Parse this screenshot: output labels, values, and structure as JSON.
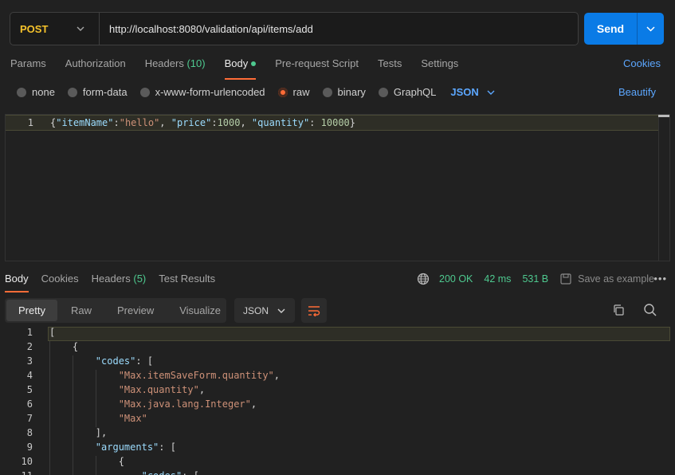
{
  "request": {
    "method": "POST",
    "url": "http://localhost:8080/validation/api/items/add",
    "send_label": "Send",
    "tabs": [
      {
        "label": "Params"
      },
      {
        "label": "Authorization"
      },
      {
        "label": "Headers",
        "count": "(10)"
      },
      {
        "label": "Body"
      },
      {
        "label": "Pre-request Script"
      },
      {
        "label": "Tests"
      },
      {
        "label": "Settings"
      }
    ],
    "cookies_label": "Cookies",
    "body_types": [
      "none",
      "form-data",
      "x-www-form-urlencoded",
      "raw",
      "binary",
      "GraphQL"
    ],
    "selected_body_type": "raw",
    "format": "JSON",
    "beautify_label": "Beautify",
    "editor": {
      "line_number": "1",
      "code": "{\"itemName\":\"hello\", \"price\":1000, \"quantity\": 10000}"
    }
  },
  "response": {
    "tabs": [
      {
        "label": "Body"
      },
      {
        "label": "Cookies"
      },
      {
        "label": "Headers",
        "count": "(5)"
      },
      {
        "label": "Test Results"
      }
    ],
    "status": "200 OK",
    "time": "42 ms",
    "size": "531 B",
    "save_example_label": "Save as example",
    "more_label": "•••",
    "view_tabs": [
      "Pretty",
      "Raw",
      "Preview",
      "Visualize"
    ],
    "format": "JSON",
    "lines": [
      {
        "n": "1",
        "tokens": [
          {
            "t": "[",
            "c": "p"
          }
        ]
      },
      {
        "n": "2",
        "tokens": [
          {
            "t": "    {",
            "c": "p"
          }
        ]
      },
      {
        "n": "3",
        "tokens": [
          {
            "t": "        ",
            "c": "p"
          },
          {
            "t": "\"codes\"",
            "c": "k"
          },
          {
            "t": ": [",
            "c": "p"
          }
        ]
      },
      {
        "n": "4",
        "tokens": [
          {
            "t": "            ",
            "c": "p"
          },
          {
            "t": "\"Max.itemSaveForm.quantity\"",
            "c": "s"
          },
          {
            "t": ",",
            "c": "p"
          }
        ]
      },
      {
        "n": "5",
        "tokens": [
          {
            "t": "            ",
            "c": "p"
          },
          {
            "t": "\"Max.quantity\"",
            "c": "s"
          },
          {
            "t": ",",
            "c": "p"
          }
        ]
      },
      {
        "n": "6",
        "tokens": [
          {
            "t": "            ",
            "c": "p"
          },
          {
            "t": "\"Max.java.lang.Integer\"",
            "c": "s"
          },
          {
            "t": ",",
            "c": "p"
          }
        ]
      },
      {
        "n": "7",
        "tokens": [
          {
            "t": "            ",
            "c": "p"
          },
          {
            "t": "\"Max\"",
            "c": "s"
          }
        ]
      },
      {
        "n": "8",
        "tokens": [
          {
            "t": "        ],",
            "c": "p"
          }
        ]
      },
      {
        "n": "9",
        "tokens": [
          {
            "t": "        ",
            "c": "p"
          },
          {
            "t": "\"arguments\"",
            "c": "k"
          },
          {
            "t": ": [",
            "c": "p"
          }
        ]
      },
      {
        "n": "10",
        "tokens": [
          {
            "t": "            {",
            "c": "p"
          }
        ]
      },
      {
        "n": "11",
        "tokens": [
          {
            "t": "                ",
            "c": "p"
          },
          {
            "t": "\"codes\"",
            "c": "k"
          },
          {
            "t": ": [",
            "c": "p"
          }
        ]
      }
    ]
  },
  "colors": {
    "accent_orange": "#ff6c37",
    "link_blue": "#5ca7ff",
    "send_blue": "#0a7be6",
    "method_yellow": "#f5c22b",
    "status_green": "#4ec98f"
  }
}
